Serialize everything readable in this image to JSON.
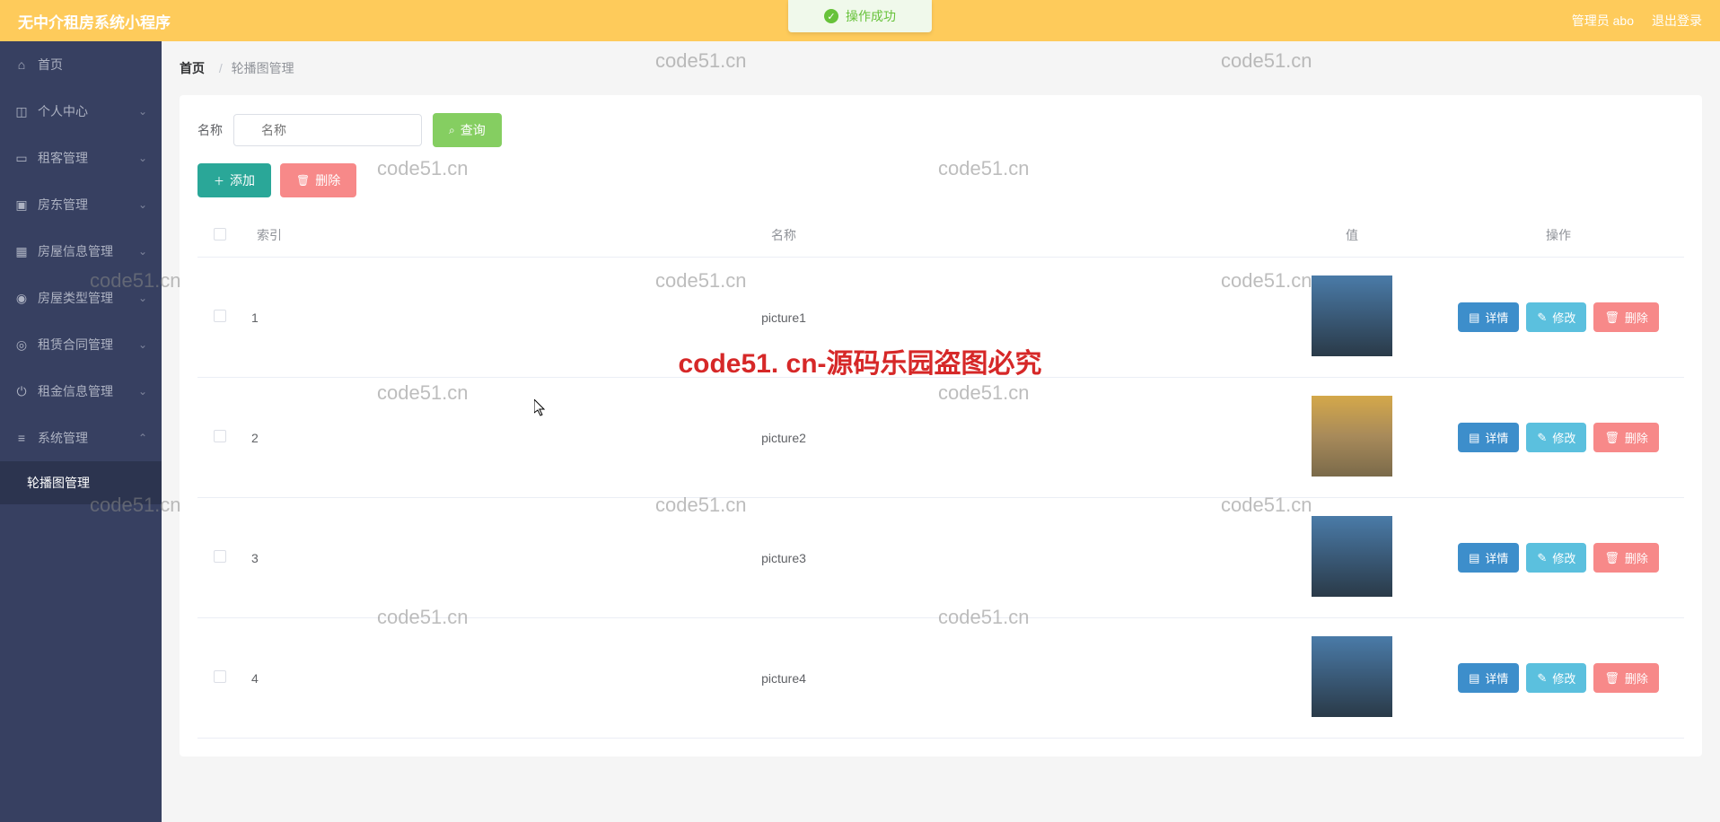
{
  "header": {
    "title": "无中介租房系统小程序",
    "admin_label": "管理员 abo",
    "logout_label": "退出登录"
  },
  "toast": {
    "text": "操作成功"
  },
  "sidebar": {
    "items": [
      {
        "label": "首页",
        "icon": "home",
        "collapsible": false
      },
      {
        "label": "个人中心",
        "icon": "user",
        "collapsible": true
      },
      {
        "label": "租客管理",
        "icon": "laptop",
        "collapsible": true
      },
      {
        "label": "房东管理",
        "icon": "clipboard",
        "collapsible": true
      },
      {
        "label": "房屋信息管理",
        "icon": "grid",
        "collapsible": true
      },
      {
        "label": "房屋类型管理",
        "icon": "person",
        "collapsible": true
      },
      {
        "label": "租赁合同管理",
        "icon": "target",
        "collapsible": true
      },
      {
        "label": "租金信息管理",
        "icon": "power",
        "collapsible": true
      },
      {
        "label": "系统管理",
        "icon": "menu",
        "collapsible": true,
        "expanded": true
      }
    ],
    "subitem": "轮播图管理"
  },
  "breadcrumb": {
    "home": "首页",
    "current": "轮播图管理"
  },
  "search": {
    "label": "名称",
    "placeholder": "名称",
    "query_btn": "查询"
  },
  "actions": {
    "add": "添加",
    "delete": "删除"
  },
  "table": {
    "headers": {
      "index": "索引",
      "name": "名称",
      "value": "值",
      "ops": "操作"
    },
    "ops": {
      "detail": "详情",
      "edit": "修改",
      "delete": "删除"
    },
    "rows": [
      {
        "index": "1",
        "name": "picture1",
        "thumb": "blue"
      },
      {
        "index": "2",
        "name": "picture2",
        "thumb": "alt"
      },
      {
        "index": "3",
        "name": "picture3",
        "thumb": "blue"
      },
      {
        "index": "4",
        "name": "picture4",
        "thumb": "blue"
      }
    ]
  },
  "watermarks": {
    "small": "code51.cn",
    "big": "code51. cn-源码乐园盗图必究"
  }
}
